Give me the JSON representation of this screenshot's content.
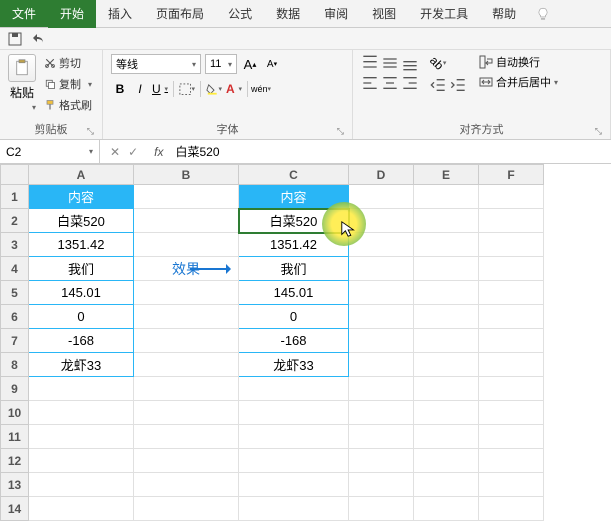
{
  "tabs": {
    "file": "文件",
    "items": [
      "开始",
      "插入",
      "页面布局",
      "公式",
      "数据",
      "审阅",
      "视图",
      "开发工具",
      "帮助"
    ],
    "active_index": 0,
    "tell_me": "Q"
  },
  "ribbon": {
    "clipboard": {
      "paste": "粘贴",
      "cut": "剪切",
      "copy": "复制",
      "format_painter": "格式刷",
      "label": "剪贴板"
    },
    "font": {
      "name": "等线",
      "size": "11",
      "grow": "A",
      "shrink": "A",
      "bold": "B",
      "italic": "I",
      "underline": "U",
      "wen": "wén",
      "label": "字体"
    },
    "align": {
      "wrap": "自动换行",
      "merge": "合并后居中",
      "label": "对齐方式"
    }
  },
  "namebox": "C2",
  "formula": "白菜520",
  "columns": [
    "A",
    "B",
    "C",
    "D",
    "E",
    "F"
  ],
  "rows": [
    "1",
    "2",
    "3",
    "4",
    "5",
    "6",
    "7",
    "8",
    "9",
    "10",
    "11",
    "12",
    "13",
    "14"
  ],
  "header_text": "内容",
  "arrow_label": "效果",
  "colA_data": [
    "白菜520",
    "1351.42",
    "我们",
    "145.01",
    "0",
    "-168",
    "龙虾33"
  ],
  "colC_data": [
    "白菜520",
    "1351.42",
    "我们",
    "145.01",
    "0",
    "-168",
    "龙虾33"
  ],
  "icons": {
    "cut": "cut-icon",
    "copy": "copy-icon",
    "brush": "brush-icon",
    "border": "border-icon",
    "fill": "fill-icon",
    "fontcolor": "fontcolor-icon",
    "align": "align-icon",
    "indent": "indent-icon",
    "wrap": "wrap-icon",
    "merge": "merge-icon"
  }
}
